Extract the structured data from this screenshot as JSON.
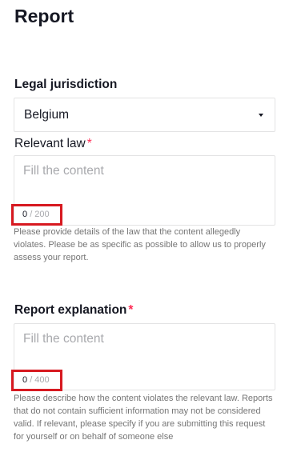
{
  "page": {
    "title": "Report"
  },
  "jurisdiction": {
    "label": "Legal jurisdiction",
    "selected": "Belgium"
  },
  "relevant_law": {
    "label": "Relevant law",
    "required_mark": "*",
    "placeholder": "Fill the content",
    "count_current": "0",
    "count_max": "/ 200",
    "helper": "Please provide details of the law that the content allegedly violates. Please be as specific as possible to allow us to properly assess your report."
  },
  "report_explanation": {
    "label": "Report explanation",
    "required_mark": "*",
    "placeholder": "Fill the content",
    "count_current": "0",
    "count_max": "/ 400",
    "helper": "Please describe how the content violates the relevant law. Reports that do not contain sufficient information may not be considered valid. If relevant, please specify if you are submitting this request for yourself or on behalf of someone else"
  },
  "colors": {
    "required": "#fe2c55",
    "highlight_box": "#d71920",
    "placeholder": "#a8a9ad",
    "helper_text": "#757575",
    "border": "#e3e3e4"
  }
}
